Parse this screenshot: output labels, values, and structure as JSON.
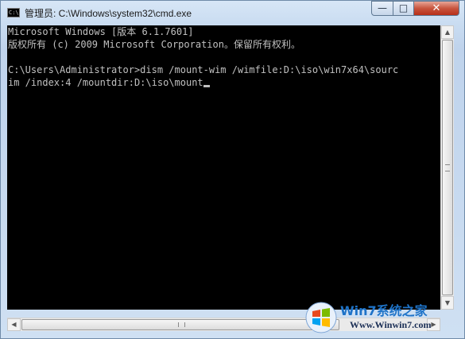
{
  "window": {
    "title": "管理员: C:\\Windows\\system32\\cmd.exe",
    "icon": "cmd-icon",
    "icon_text": "C:\\"
  },
  "controls": {
    "minimize_glyph": "—",
    "maximize_glyph": "□",
    "close_glyph": "✕"
  },
  "console": {
    "lines": [
      "Microsoft Windows [版本 6.1.7601]",
      "版权所有 (c) 2009 Microsoft Corporation。保留所有权利。",
      "",
      "C:\\Users\\Administrator>dism /mount-wim /wimfile:D:\\iso\\win7x64\\sourc",
      "im /index:4 /mountdir:D:\\iso\\mount"
    ],
    "text_color": "#c0c0c0",
    "background": "#000000"
  },
  "scrollbars": {
    "up_glyph": "▲",
    "down_glyph": "▼",
    "left_glyph": "◀",
    "right_glyph": "▶"
  },
  "watermark": {
    "title": "Win7系统之家",
    "url": "Www.Winwin7.com"
  }
}
